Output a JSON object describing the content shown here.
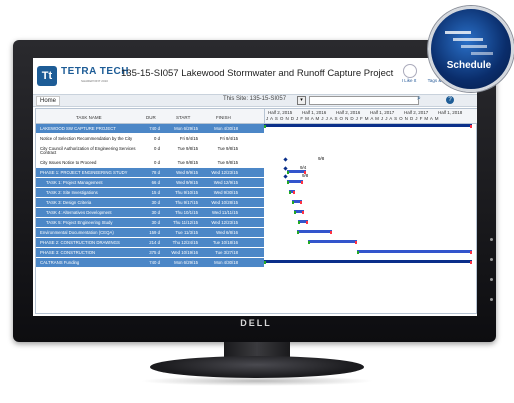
{
  "brand": {
    "name": "TETRA TECH",
    "sub": "SHAREPOINT 2010",
    "logo": "Tt"
  },
  "page_title": "135-15-SI057 Lakewood Stormwater and Runoff Capture Project",
  "header_actions": [
    {
      "label": "I Like It",
      "icon": "thumbs-up-icon"
    },
    {
      "label": "Tags & Notes",
      "icon": "tag-icon"
    }
  ],
  "nav": {
    "home": "Home",
    "this_site": "This Site: 135-15-SI057"
  },
  "columns": {
    "task": "TASK NAME",
    "dur": "DUR",
    "start": "START",
    "finish": "FINISH"
  },
  "periods": [
    "Half 2, 2015",
    "Half 1, 2016",
    "Half 2, 2016",
    "Half 1, 2017",
    "Half 2, 2017",
    "Half 1, 2018"
  ],
  "months": "J A S O N D J F M A M J J A S O N D J F M A M J J A S O N D J F M A M",
  "rows": [
    {
      "task": "LAKEWOOD SW CAPTURE PROJECT",
      "dur": "740 d",
      "start": "Mon 6/29/15",
      "finish": "Mon 4/30/18"
    },
    {
      "task": "Notice of Selection Recommendation by the City",
      "dur": "0 d",
      "start": "Fri 9/4/15",
      "finish": "Fri 9/4/15"
    },
    {
      "task": "City Council Authorization of Engineering Services",
      "task2": "Contract",
      "dur": "0 d",
      "start": "Tue 9/8/15",
      "finish": "Tue 9/8/15"
    },
    {
      "task": "City Issues Notice to Proceed",
      "dur": "0 d",
      "start": "Tue 9/8/15",
      "finish": "Tue 9/8/15"
    },
    {
      "task": "PHASE 1: PROJECT ENGINEERING STUDY",
      "dur": "78 d",
      "start": "Wed 9/9/15",
      "finish": "Wed 12/23/15"
    },
    {
      "task": "TASK 1: Project Management",
      "dur": "66 d",
      "start": "Wed 9/9/15",
      "finish": "Wed 12/9/15"
    },
    {
      "task": "TASK 2: Site Investigations",
      "dur": "15 d",
      "start": "Thu 9/10/15",
      "finish": "Wed 9/30/15"
    },
    {
      "task": "TASK 3: Design Criteria",
      "dur": "30 d",
      "start": "Thu 9/17/15",
      "finish": "Wed 10/28/15"
    },
    {
      "task": "TASK 4: Alternatives Development",
      "dur": "30 d",
      "start": "Thu 10/1/15",
      "finish": "Wed 11/11/15"
    },
    {
      "task": "TASK 5: Project Engineering Study",
      "dur": "30 d",
      "start": "Thu 11/12/15",
      "finish": "Wed 12/23/15"
    },
    {
      "task": "Environmental Documentation (CEQA)",
      "dur": "159 d",
      "start": "Tue 11/3/15",
      "finish": "Wed 6/8/16"
    },
    {
      "task": "PHASE 2: CONSTRUCTION DRAWINGS",
      "dur": "214 d",
      "start": "Thu 12/24/15",
      "finish": "Tue 10/18/16"
    },
    {
      "task": "PHASE 3: CONSTRUCTION",
      "dur": "375 d",
      "start": "Wed 10/19/16",
      "finish": "Tue 3/27/18"
    },
    {
      "task": "CALTRANS Funding",
      "dur": "740 d",
      "start": "Mon 6/29/15",
      "finish": "Mon 4/30/18"
    }
  ],
  "milestones": [
    "9/4",
    "9/8",
    "9/8"
  ],
  "badge": {
    "label": "Schedule"
  },
  "monitor": {
    "brand": "DELL"
  }
}
